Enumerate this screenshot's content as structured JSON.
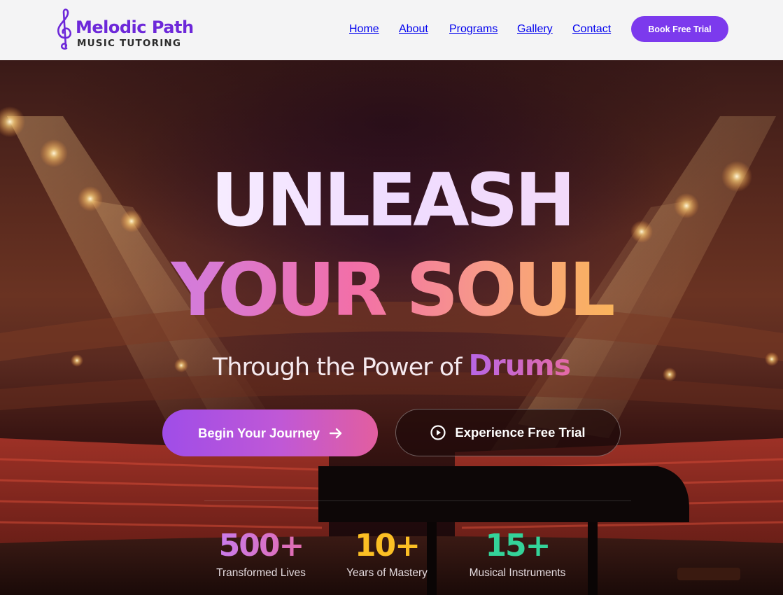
{
  "brand": {
    "name": "Melodic Path",
    "subtitle": "MUSIC TUTORING",
    "logo_icon": "treble-clef-icon",
    "primary_color": "#7c3aed"
  },
  "nav": {
    "items": [
      {
        "label": "Home"
      },
      {
        "label": "About"
      },
      {
        "label": "Programs"
      },
      {
        "label": "Gallery"
      },
      {
        "label": "Contact"
      }
    ],
    "cta_label": "Book Free Trial"
  },
  "hero": {
    "headline_line1": "UNLEASH",
    "headline_line2": "YOUR SOUL",
    "tagline_prefix": "Through the Power of",
    "tagline_highlight": "Drums",
    "primary_button": {
      "label": "Begin Your Journey",
      "icon": "arrow-right-icon"
    },
    "secondary_button": {
      "label": "Experience Free Trial",
      "icon": "play-circle-icon"
    }
  },
  "stats": [
    {
      "value": "500+",
      "label": "Transformed Lives",
      "color": "#c97ef0"
    },
    {
      "value": "10+",
      "label": "Years of Mastery",
      "color": "#fbbf24"
    },
    {
      "value": "15+",
      "label": "Musical Instruments",
      "color": "#34d399"
    }
  ]
}
